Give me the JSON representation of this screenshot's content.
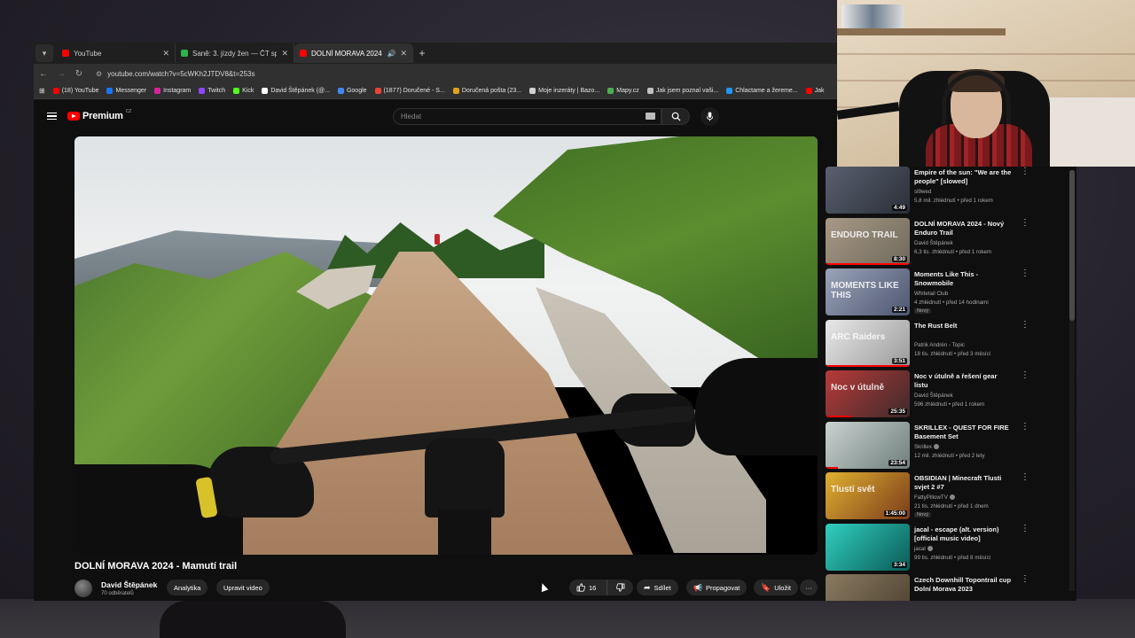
{
  "browser": {
    "tabs": [
      {
        "label": "YouTube",
        "favicon_color": "#ff0000",
        "active": false
      },
      {
        "label": "Saně: 3. jízdy žen — ČT sport —",
        "favicon_color": "#2fb34a",
        "active": false
      },
      {
        "label": "DOLNÍ MORAVA 2024 - Ma",
        "favicon_color": "#ff0000",
        "active": true
      }
    ],
    "new_tab": "+",
    "url": "youtube.com/watch?v=5cWKh2JTDV8&t=253s",
    "bookmarks": [
      {
        "label": "(18) YouTube",
        "color": "#ff0000"
      },
      {
        "label": "Messenger",
        "color": "#1877f2"
      },
      {
        "label": "Instagram",
        "color": "#d6249f"
      },
      {
        "label": "Twitch",
        "color": "#9146ff"
      },
      {
        "label": "Kick",
        "color": "#53fc18"
      },
      {
        "label": "David Štěpánek (@...",
        "color": "#ffffff"
      },
      {
        "label": "Google",
        "color": "#4285f4"
      },
      {
        "label": "(1877) Doručené - S...",
        "color": "#ea4335"
      },
      {
        "label": "Doručená pošta (23...",
        "color": "#e0a020"
      },
      {
        "label": "Moje inzeráty | Bazo...",
        "color": "#d0d0d0"
      },
      {
        "label": "Mapy.cz",
        "color": "#4caf50"
      },
      {
        "label": "Jak jsem poznal vaši...",
        "color": "#c0c0c0"
      },
      {
        "label": "Chlactame a žereme...",
        "color": "#2196f3"
      },
      {
        "label": "Jak",
        "color": "#ff0000"
      }
    ]
  },
  "masthead": {
    "brand": "Premium",
    "region": "CZ",
    "search_placeholder": "Hledat"
  },
  "video": {
    "title": "DOLNÍ MORAVA 2024 - Mamutí trail",
    "channel": "David Štěpánek",
    "subscribers": "70 odběratelů",
    "analytics_label": "Analytika",
    "edit_label": "Upravit video",
    "likes": "16",
    "share_label": "Sdílet",
    "promote_label": "Propagovat",
    "save_label": "Uložit",
    "more_label": "···"
  },
  "recommendations": [
    {
      "title": "Empire of the sun: \"We are the people\" [slowed]",
      "channel": "sl9wed",
      "stats": "5,8 mil. zhlédnutí • před 1 rokem",
      "duration": "4:49",
      "badge": "",
      "thumb_colors": [
        "#5a6070",
        "#2a2f38"
      ],
      "thumb_text": "",
      "progress": 0
    },
    {
      "title": "DOLNÍ MORAVA 2024 - Nový Enduro Trail",
      "channel": "David Štěpánek",
      "stats": "6,3 tis. zhlédnutí • před 1 rokem",
      "duration": "8:30",
      "badge": "",
      "thumb_colors": [
        "#a89886",
        "#6f6a5c"
      ],
      "thumb_text": "ENDURO TRAIL",
      "progress": 1
    },
    {
      "title": "Moments Like This - Snowmobile",
      "channel": "Whitetail Club",
      "stats": "4 zhlédnutí • před 14 hodinami",
      "duration": "2:21",
      "badge": "Nový",
      "thumb_colors": [
        "#9aa4b8",
        "#4d5670"
      ],
      "thumb_text": "MOMENTS LIKE THIS",
      "progress": 0
    },
    {
      "title": "The Rust Belt",
      "channel": "Patrik Andrén - Topic",
      "stats": "18 tis. zhlédnutí • před 3 měsíci",
      "duration": "3:51",
      "badge": "",
      "thumb_colors": [
        "#e8e8e8",
        "#9a9a9a"
      ],
      "thumb_text": "ARC Raiders",
      "progress": 1
    },
    {
      "title": "Noc v útulně a řešení gear listu",
      "channel": "David Štěpánek",
      "stats": "596 zhlédnutí • před 1 rokem",
      "duration": "25:35",
      "badge": "",
      "thumb_colors": [
        "#b83a3a",
        "#3d2a2a"
      ],
      "thumb_text": "Noc v útulně",
      "progress": 0.3
    },
    {
      "title": "SKRILLEX - QUEST FOR FIRE Basement Set",
      "channel": "Skrillex",
      "stats": "12 mil. zhlédnutí • před 2 lety",
      "duration": "23:54",
      "badge": "",
      "thumb_colors": [
        "#c9d2d0",
        "#6f7f7c"
      ],
      "thumb_text": "",
      "progress": 0.15
    },
    {
      "title": "OBSIDIAN | Minecraft Tlusti svjet 2 #7",
      "channel": "FattyPillowTV",
      "stats": "21 tis. zhlédnutí • před 1 dnem",
      "duration": "1:45:00",
      "badge": "Nový",
      "thumb_colors": [
        "#e0b030",
        "#7a3b1b"
      ],
      "thumb_text": "Tlustí svět",
      "progress": 0
    },
    {
      "title": "jacal - escape (alt. version) [official music video]",
      "channel": "jacal",
      "stats": "99 tis. zhlédnutí • před 8 měsíci",
      "duration": "3:34",
      "badge": "",
      "thumb_colors": [
        "#30d0c0",
        "#0b5a55"
      ],
      "thumb_text": "",
      "progress": 0
    },
    {
      "title": "Czech Downhill Topontrail cup Dolní Morava 2023",
      "channel": "",
      "stats": "",
      "duration": "",
      "badge": "",
      "thumb_colors": [
        "#8a7a60",
        "#4a3f2f"
      ],
      "thumb_text": "",
      "progress": 0
    }
  ]
}
